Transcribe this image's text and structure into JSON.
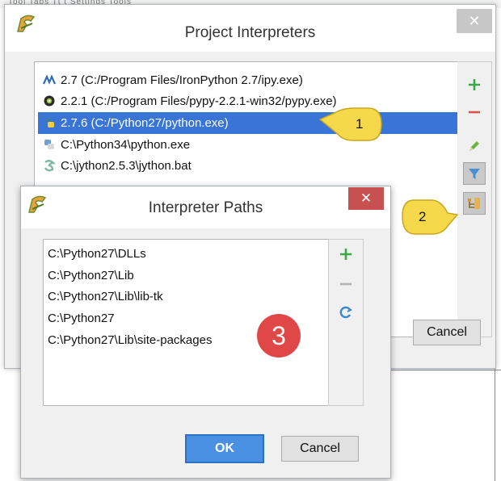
{
  "background_window": {
    "faint_title": "Tool  Tabs  Tt  t  Settings  Tools"
  },
  "project_interpreters_dialog": {
    "title": "Project Interpreters",
    "close_label": "✕",
    "interpreters": [
      {
        "label": "2.7 (C:/Program Files/IronPython 2.7/ipy.exe)",
        "icon": "ironpython-icon",
        "selected": false
      },
      {
        "label": "2.2.1 (C:/Program Files/pypy-2.2.1-win32/pypy.exe)",
        "icon": "pypy-icon",
        "selected": false
      },
      {
        "label": "2.7.6 (C:/Python27/python.exe)",
        "icon": "python-icon",
        "selected": true
      },
      {
        "label": "C:\\Python34\\python.exe",
        "icon": "python-icon",
        "selected": false
      },
      {
        "label": "C:\\jython2.5.3\\jython.bat",
        "icon": "jython-icon",
        "selected": false
      }
    ],
    "toolbar": [
      "add-icon",
      "remove-icon",
      "edit-icon",
      "filter-icon",
      "show-paths-icon"
    ],
    "cancel_label": "Cancel",
    "callouts": {
      "one": "1",
      "two": "2"
    }
  },
  "interpreter_paths_dialog": {
    "title": "Interpreter Paths",
    "close_label": "✕",
    "paths": [
      "C:\\Python27\\DLLs",
      "C:\\Python27\\Lib",
      "C:\\Python27\\Lib\\lib-tk",
      "C:\\Python27",
      "C:\\Python27\\Lib\\site-packages"
    ],
    "toolbar": [
      "add-icon",
      "remove-icon",
      "reload-icon"
    ],
    "ok_label": "OK",
    "cancel_label": "Cancel",
    "badge": "3"
  },
  "colors": {
    "selection": "#3875d7",
    "ok_button": "#4a90e2",
    "close_red": "#c75050",
    "callout_yellow": "#f5d94a",
    "badge_red": "#e04848",
    "add_green": "#3aa845",
    "remove_red": "#d9534f"
  }
}
